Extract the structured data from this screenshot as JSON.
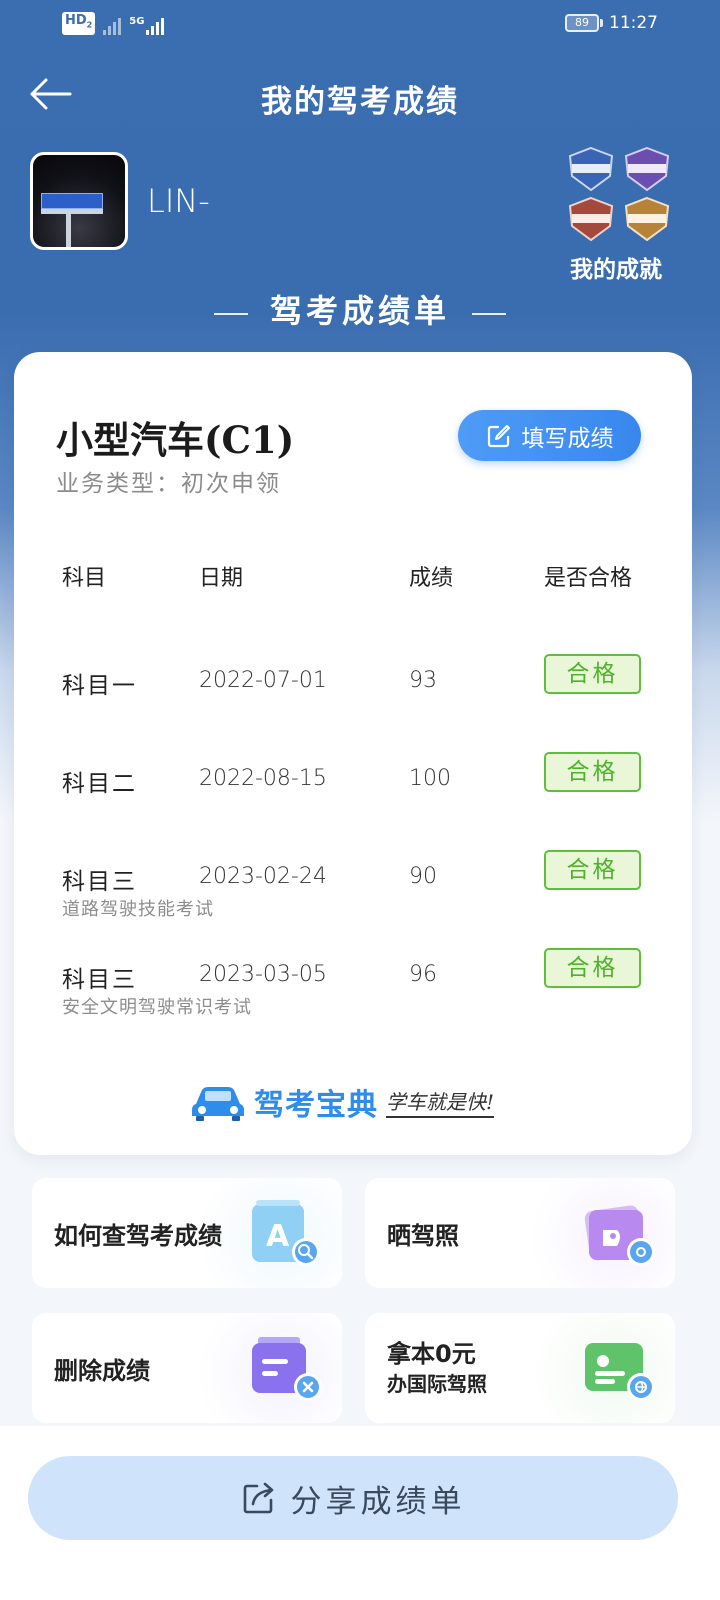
{
  "status_bar": {
    "network_label": "HD",
    "network_badge": "2",
    "signal_label": "5G",
    "battery": "89",
    "time": "11:27"
  },
  "header": {
    "title": "我的驾考成绩"
  },
  "user": {
    "name": "LIN-"
  },
  "achievements": {
    "label": "我的成就"
  },
  "section": {
    "title": "驾考成绩单"
  },
  "license": {
    "vehicle": "小型汽车(C1)",
    "business_type": "业务类型：初次申领",
    "fill_button": "填写成绩"
  },
  "table": {
    "headers": [
      "科目",
      "日期",
      "成绩",
      "是否合格"
    ],
    "rows": [
      {
        "subject": "科目一",
        "date": "2022-07-01",
        "score": "93",
        "result": "合格",
        "note": ""
      },
      {
        "subject": "科目二",
        "date": "2022-08-15",
        "score": "100",
        "result": "合格",
        "note": ""
      },
      {
        "subject": "科目三",
        "date": "2023-02-24",
        "score": "90",
        "result": "合格",
        "note": "道路驾驶技能考试"
      },
      {
        "subject": "科目三",
        "date": "2023-03-05",
        "score": "96",
        "result": "合格",
        "note": "安全文明驾驶常识考试"
      }
    ]
  },
  "brand": {
    "name": "驾考宝典",
    "slogan": "学车就是快!"
  },
  "tiles": [
    {
      "label": "如何查驾考成绩",
      "icon": "search-doc-icon",
      "color": "#9fd6f5"
    },
    {
      "label": "晒驾照",
      "icon": "photo-icon",
      "color": "#c49cf0"
    },
    {
      "label": "删除成绩",
      "icon": "delete-doc-icon",
      "color": "#8f7af2"
    },
    {
      "label_line1": "拿本0元",
      "label_line2": "办国际驾照",
      "icon": "license-card-icon",
      "color": "#6fd07a"
    }
  ],
  "share": {
    "label": "分享成绩单"
  },
  "colors": {
    "primary_blue": "#3b6db1",
    "button_blue": "#3887ee",
    "pass_green": "#4eb22a"
  }
}
